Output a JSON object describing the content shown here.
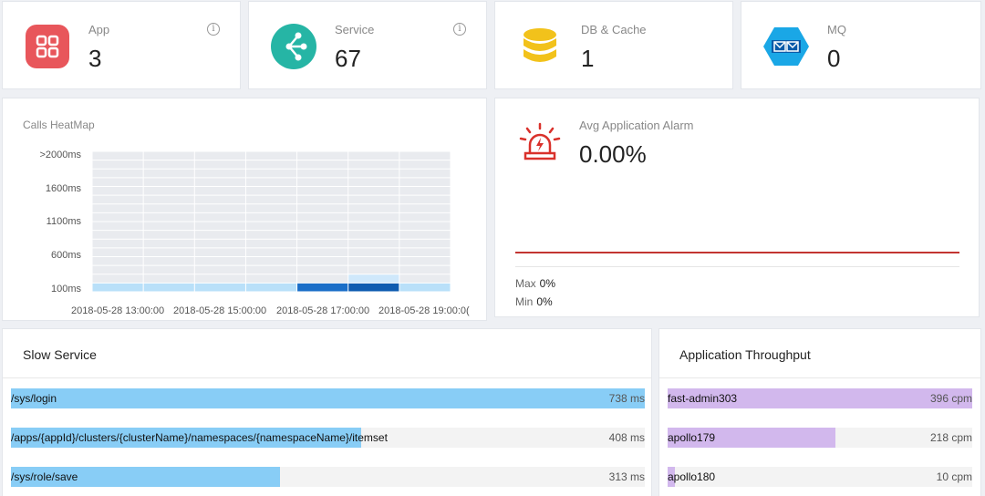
{
  "stats": [
    {
      "label": "App",
      "value": "3",
      "icon": "app-grid-icon",
      "color": "#e8565b",
      "info": true
    },
    {
      "label": "Service",
      "value": "67",
      "icon": "service-graph-icon",
      "color": "#26b5a5",
      "info": true
    },
    {
      "label": "DB & Cache",
      "value": "1",
      "icon": "database-icon",
      "color": "#f2c21b",
      "info": false
    },
    {
      "label": "MQ",
      "value": "0",
      "icon": "mq-mail-icon",
      "color": "#1aa7e6",
      "info": false
    }
  ],
  "info_glyph": "i",
  "heatmap": {
    "title": "Calls HeatMap",
    "y_labels": [
      ">2000ms",
      "1600ms",
      "1100ms",
      "600ms",
      "100ms"
    ],
    "x_labels": [
      "2018-05-28 13:00:00",
      "2018-05-28 15:00:00",
      "2018-05-28 17:00:00",
      "2018-05-28 19:00:0("
    ],
    "columns": 7,
    "rows": 16,
    "hot_cells": [
      {
        "col": 0,
        "row": 0,
        "level": 1
      },
      {
        "col": 1,
        "row": 0,
        "level": 1
      },
      {
        "col": 2,
        "row": 0,
        "level": 1
      },
      {
        "col": 3,
        "row": 0,
        "level": 1
      },
      {
        "col": 4,
        "row": 0,
        "level": 3
      },
      {
        "col": 5,
        "row": 0,
        "level": 4
      },
      {
        "col": 5,
        "row": 1,
        "level": 2
      },
      {
        "col": 6,
        "row": 0,
        "level": 1
      }
    ],
    "level_colors": [
      "#e9ebef",
      "#b9e0f9",
      "#cfe8fb",
      "#1a6ec8",
      "#0e5bb0"
    ]
  },
  "alarm": {
    "title": "Avg Application Alarm",
    "value": "0.00%",
    "icon": "alarm-siren-icon",
    "max_label": "Max",
    "max_value": "0%",
    "min_label": "Min",
    "min_value": "0%",
    "line_color": "#c23531"
  },
  "slow_service": {
    "title": "Slow Service",
    "fill_color": "#88cdf6",
    "items": [
      {
        "label": "/sys/login",
        "value": "738 ms",
        "ratio": 1.0
      },
      {
        "label": "/apps/{appId}/clusters/{clusterName}/namespaces/{namespaceName}/itemset",
        "value": "408 ms",
        "ratio": 0.553
      },
      {
        "label": "/sys/role/save",
        "value": "313 ms",
        "ratio": 0.424
      }
    ]
  },
  "throughput": {
    "title": "Application Throughput",
    "fill_color": "#d2b8ed",
    "items": [
      {
        "label": "fast-admin303",
        "value": "396 cpm",
        "ratio": 1.0
      },
      {
        "label": "apollo179",
        "value": "218 cpm",
        "ratio": 0.55
      },
      {
        "label": "apollo180",
        "value": "10 cpm",
        "ratio": 0.025
      }
    ]
  }
}
